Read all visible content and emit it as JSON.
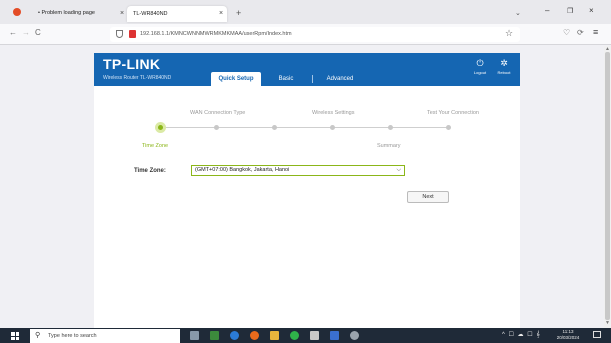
{
  "browser": {
    "tabs": [
      {
        "label": "• Problem loading page",
        "active": false
      },
      {
        "label": "TL-WR840ND",
        "active": true
      }
    ],
    "close_glyph": "×",
    "new_tab_glyph": "+",
    "list_tabs_glyph": "⌄",
    "window_controls": {
      "minimize": "–",
      "maximize": "❐",
      "close": "×"
    },
    "nav": {
      "back": "←",
      "forward": "→",
      "reload": "C"
    },
    "url": "192.168.1.1/KMNCWNNMWRMKMKMAA/userRpm/Index.htm",
    "icons": {
      "star": "☆",
      "pocket": "♡",
      "extensions": "⟳",
      "menu": "≡"
    }
  },
  "router": {
    "brand": "TP-LINK",
    "model": "Wireless Router TL-WR840ND",
    "tabs": [
      {
        "label": "Quick Setup",
        "active": true
      },
      {
        "label": "Basic",
        "active": false
      },
      {
        "label": "Advanced",
        "active": false
      }
    ],
    "header_buttons": {
      "logout": {
        "label": "Logout",
        "icon": "⏻"
      },
      "reboot": {
        "label": "Reboot",
        "icon": "✲"
      }
    },
    "steps_top": [
      "WAN Connection Type",
      "Wireless Settings",
      "Test Your Connection"
    ],
    "steps_bottom": [
      "Time Zone",
      "Summary"
    ],
    "current_step": "Time Zone",
    "time_zone_label": "Time Zone:",
    "time_zone_value": "(GMT+07:00) Bangkok, Jakarta, Hanoi",
    "dropdown_glyph": "⌵",
    "next_label": "Next"
  },
  "taskbar": {
    "search_placeholder": "Type here to search",
    "search_glyph": "⚲",
    "tray_text": "^ ☐ ☁ ☐ 𝄞",
    "time": "11:13",
    "date": "20/03/2024"
  },
  "colors": {
    "router_blue": "#1566b2",
    "active_green": "#8bb619",
    "taskbar": "#1f2a38"
  }
}
